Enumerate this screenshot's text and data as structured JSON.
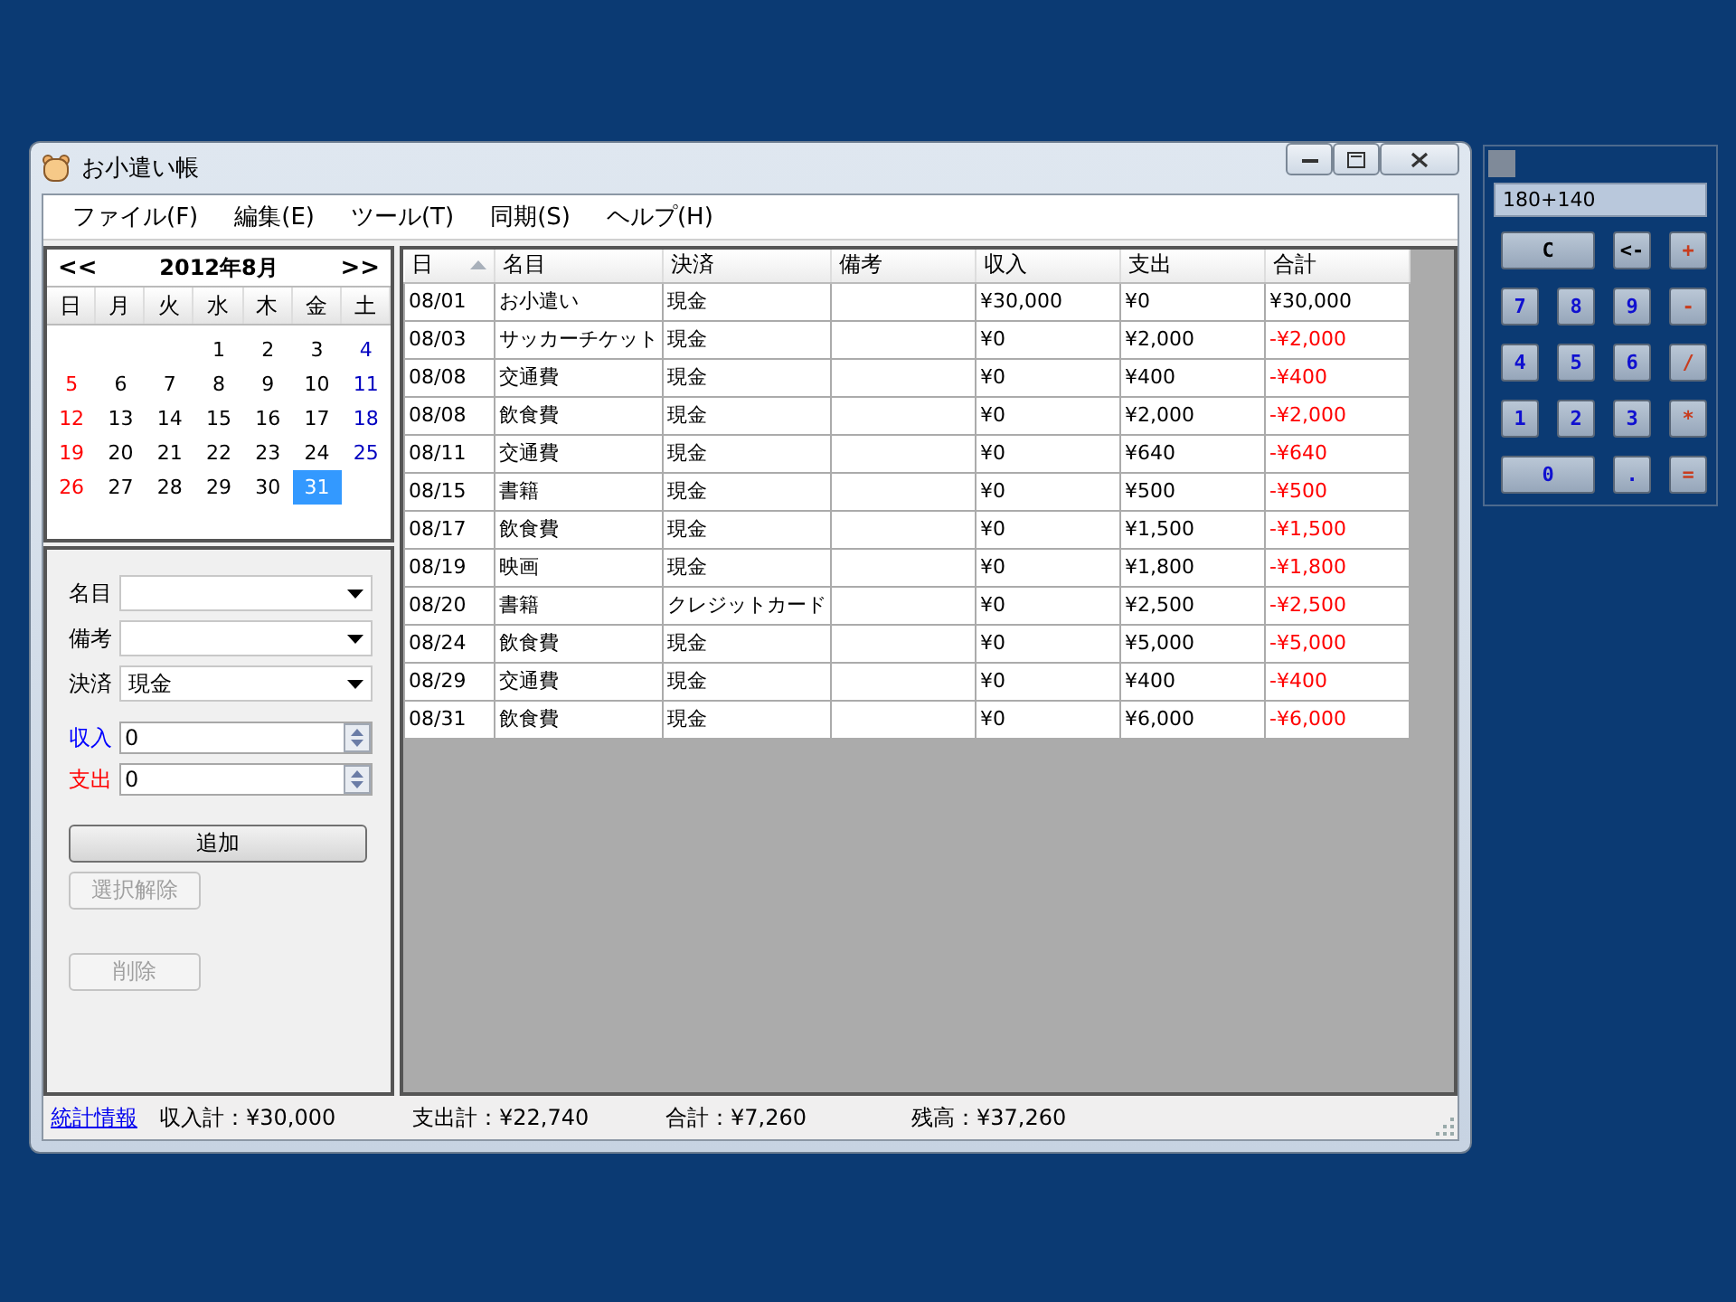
{
  "window": {
    "title": "お小遣い帳"
  },
  "menu": [
    "ファイル(F)",
    "編集(E)",
    "ツール(T)",
    "同期(S)",
    "ヘルプ(H)"
  ],
  "calendar": {
    "prev": "<<",
    "title": "2012年8月",
    "next": ">>",
    "weekdays": [
      "日",
      "月",
      "火",
      "水",
      "木",
      "金",
      "土"
    ],
    "weeks": [
      {
        "right_aligned": true,
        "days": [
          {
            "day": "1",
            "selected": false
          },
          {
            "day": "2",
            "selected": false
          },
          {
            "day": "3",
            "selected": false
          },
          {
            "day": "4",
            "selected": false
          }
        ]
      },
      {
        "days": [
          {
            "day": "5",
            "selected": false
          },
          {
            "day": "6",
            "selected": false
          },
          {
            "day": "7",
            "selected": false
          },
          {
            "day": "8",
            "selected": false
          },
          {
            "day": "9",
            "selected": false
          },
          {
            "day": "10",
            "selected": false
          },
          {
            "day": "11",
            "selected": false
          }
        ]
      },
      {
        "days": [
          {
            "day": "12",
            "selected": false
          },
          {
            "day": "13",
            "selected": false
          },
          {
            "day": "14",
            "selected": false
          },
          {
            "day": "15",
            "selected": false
          },
          {
            "day": "16",
            "selected": false
          },
          {
            "day": "17",
            "selected": false
          },
          {
            "day": "18",
            "selected": false
          }
        ]
      },
      {
        "days": [
          {
            "day": "19",
            "selected": false
          },
          {
            "day": "20",
            "selected": false
          },
          {
            "day": "21",
            "selected": false
          },
          {
            "day": "22",
            "selected": false
          },
          {
            "day": "23",
            "selected": false
          },
          {
            "day": "24",
            "selected": false
          },
          {
            "day": "25",
            "selected": false
          }
        ]
      },
      {
        "right_aligned": false,
        "days": [
          {
            "day": "26",
            "selected": false
          },
          {
            "day": "27",
            "selected": false
          },
          {
            "day": "28",
            "selected": false
          },
          {
            "day": "29",
            "selected": false
          },
          {
            "day": "30",
            "selected": false
          },
          {
            "day": "31",
            "selected": true
          }
        ]
      }
    ]
  },
  "form": {
    "fields": [
      {
        "label": "名目",
        "kind": "combo"
      },
      {
        "label": "備考",
        "kind": "combo"
      },
      {
        "label": "決済",
        "kind": "combo",
        "value": "現金"
      },
      {
        "label": "収入",
        "kind": "income",
        "value": "0"
      },
      {
        "label": "支出",
        "kind": "expense",
        "value": "0"
      }
    ],
    "buttons": [
      {
        "label": "追加",
        "disabled": false,
        "wide": true
      },
      {
        "label": "選択解除",
        "disabled": true,
        "wide": false
      },
      {
        "label": "削除",
        "disabled": true,
        "wide": false
      }
    ]
  },
  "table": {
    "columns": [
      {
        "label": "日",
        "sorted": true
      },
      {
        "label": "名目",
        "sorted": false
      },
      {
        "label": "決済",
        "sorted": false
      },
      {
        "label": "備考",
        "sorted": false
      },
      {
        "label": "収入",
        "sorted": false
      },
      {
        "label": "支出",
        "sorted": false
      },
      {
        "label": "合計",
        "sorted": false
      }
    ],
    "rows": [
      {
        "date": "08/01",
        "item": "お小遣い",
        "payment": "現金",
        "income": "¥30,000",
        "expense": "¥0",
        "total": "¥30,000",
        "negative": false
      },
      {
        "date": "08/03",
        "item": "サッカーチケット",
        "payment": "現金",
        "income": "¥0",
        "expense": "¥2,000",
        "total": "-¥2,000",
        "negative": true
      },
      {
        "date": "08/08",
        "item": "交通費",
        "payment": "現金",
        "income": "¥0",
        "expense": "¥400",
        "total": "-¥400",
        "negative": true
      },
      {
        "date": "08/08",
        "item": "飲食費",
        "payment": "現金",
        "income": "¥0",
        "expense": "¥2,000",
        "total": "-¥2,000",
        "negative": true
      },
      {
        "date": "08/11",
        "item": "交通費",
        "payment": "現金",
        "income": "¥0",
        "expense": "¥640",
        "total": "-¥640",
        "negative": true
      },
      {
        "date": "08/15",
        "item": "書籍",
        "payment": "現金",
        "income": "¥0",
        "expense": "¥500",
        "total": "-¥500",
        "negative": true
      },
      {
        "date": "08/17",
        "item": "飲食費",
        "payment": "現金",
        "income": "¥0",
        "expense": "¥1,500",
        "total": "-¥1,500",
        "negative": true
      },
      {
        "date": "08/19",
        "item": "映画",
        "payment": "現金",
        "income": "¥0",
        "expense": "¥1,800",
        "total": "-¥1,800",
        "negative": true
      },
      {
        "date": "08/20",
        "item": "書籍",
        "payment": "クレジットカード",
        "income": "¥0",
        "expense": "¥2,500",
        "total": "-¥2,500",
        "negative": true
      },
      {
        "date": "08/24",
        "item": "飲食費",
        "payment": "現金",
        "income": "¥0",
        "expense": "¥5,000",
        "total": "-¥5,000",
        "negative": true
      },
      {
        "date": "08/29",
        "item": "交通費",
        "payment": "現金",
        "income": "¥0",
        "expense": "¥400",
        "total": "-¥400",
        "negative": true
      },
      {
        "date": "08/31",
        "item": "飲食費",
        "payment": "現金",
        "income": "¥0",
        "expense": "¥6,000",
        "total": "-¥6,000",
        "negative": true
      }
    ]
  },
  "status_bar": {
    "link": "統計情報",
    "items": [
      "収入計：¥30,000",
      "支出計：¥22,740",
      "合計：¥7,260",
      "残高：¥37,260"
    ]
  },
  "calculator": {
    "display": "180+140",
    "buttons": [
      {
        "label": "C",
        "kind": "control",
        "wide": true
      },
      {
        "label": "<-",
        "kind": "control",
        "wide": false
      },
      {
        "label": "+",
        "kind": "operator",
        "wide": false
      },
      {
        "label": "7",
        "kind": "digit",
        "wide": false
      },
      {
        "label": "8",
        "kind": "digit",
        "wide": false
      },
      {
        "label": "9",
        "kind": "digit",
        "wide": false
      },
      {
        "label": "-",
        "kind": "operator",
        "wide": false
      },
      {
        "label": "4",
        "kind": "digit",
        "wide": false
      },
      {
        "label": "5",
        "kind": "digit",
        "wide": false
      },
      {
        "label": "6",
        "kind": "digit",
        "wide": false
      },
      {
        "label": "/",
        "kind": "operator",
        "wide": false
      },
      {
        "label": "1",
        "kind": "digit",
        "wide": false
      },
      {
        "label": "2",
        "kind": "digit",
        "wide": false
      },
      {
        "label": "3",
        "kind": "digit",
        "wide": false
      },
      {
        "label": "*",
        "kind": "operator",
        "wide": false
      },
      {
        "label": "0",
        "kind": "digit",
        "wide": true
      },
      {
        "label": ".",
        "kind": "digit",
        "wide": false
      },
      {
        "label": "=",
        "kind": "operator",
        "wide": false
      }
    ]
  }
}
